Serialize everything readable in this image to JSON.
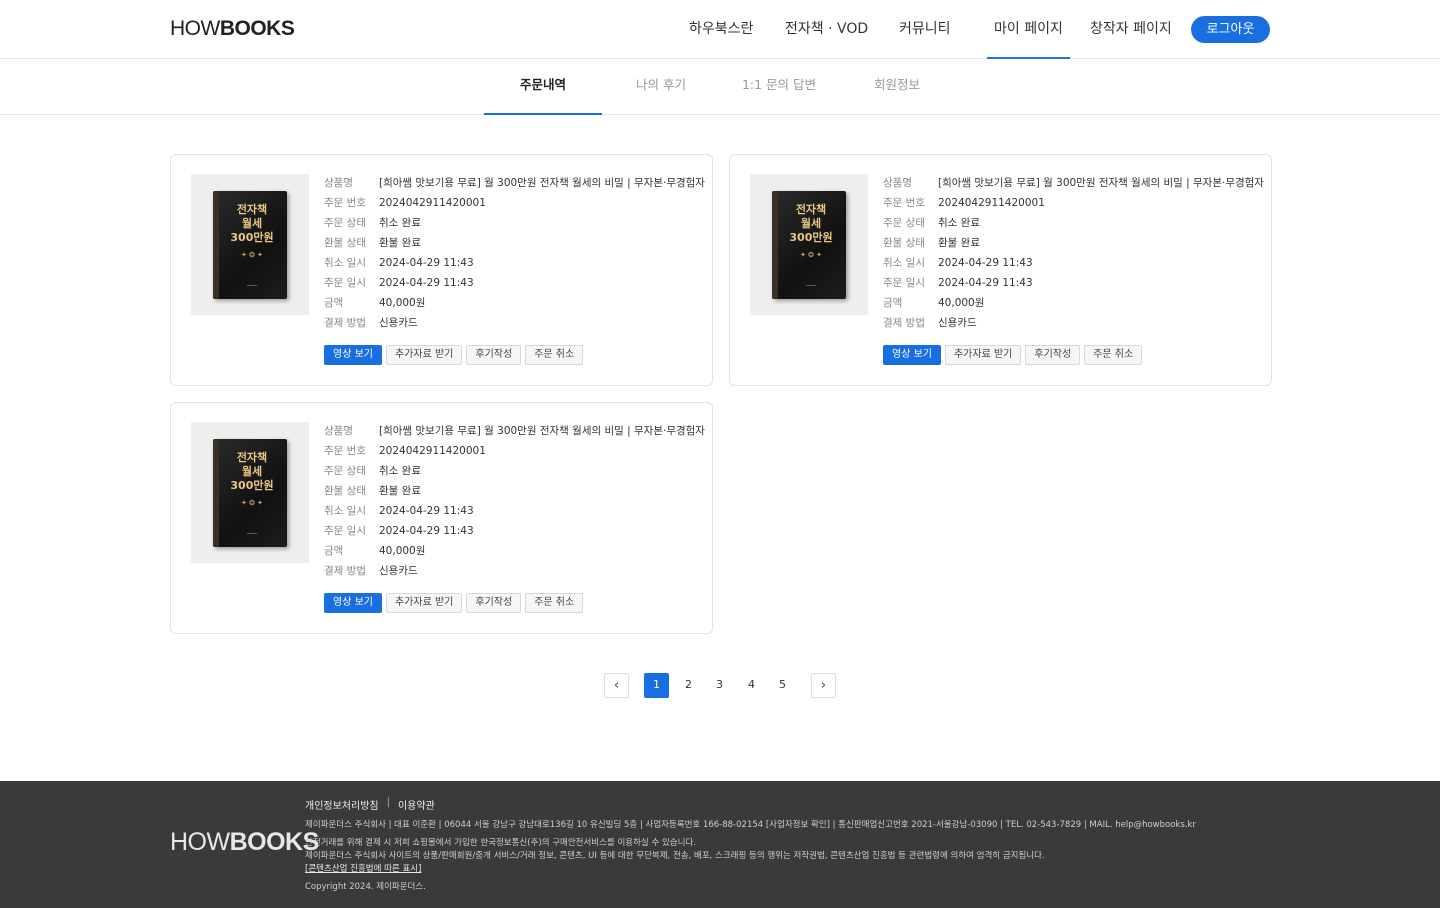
{
  "header": {
    "logo_thin": "HOW",
    "logo_bold": "BOOKS",
    "nav": [
      "하우북스란",
      "전자책 · VOD",
      "커뮤니티",
      "마이 페이지",
      "창작자 페이지"
    ],
    "logout": "로그아웃"
  },
  "tabs": [
    "주문내역",
    "나의 후기",
    "1:1 문의 답변",
    "회원정보"
  ],
  "labels": {
    "product": "상품명",
    "order_no": "주문 번호",
    "order_status": "주문 상태",
    "refund_status": "환불 상태",
    "cancel_date": "취소 일시",
    "order_date": "주문 일시",
    "amount": "금액",
    "payment": "결제 방법"
  },
  "book_cover": {
    "title_lines": [
      "전자책",
      "월세",
      "300만원"
    ]
  },
  "orders": [
    {
      "product": "[희아쌤 맛보기용 무료] 월 300만원 전자책 월세의 비밀 | 무자본·무경험자",
      "order_no": "2024042911420001",
      "order_status": "취소 완료",
      "refund_status": "환불 완료",
      "cancel_date": "2024-04-29 11:43",
      "order_date": "2024-04-29 11:43",
      "amount": "40,000원",
      "payment": "신용카드"
    },
    {
      "product": "[희아쌤 맛보기용 무료] 월 300만원 전자책 월세의 비밀 | 무자본·무경험자",
      "order_no": "2024042911420001",
      "order_status": "취소 완료",
      "refund_status": "환불 완료",
      "cancel_date": "2024-04-29 11:43",
      "order_date": "2024-04-29 11:43",
      "amount": "40,000원",
      "payment": "신용카드"
    },
    {
      "product": "[희아쌤 맛보기용 무료] 월 300만원 전자책 월세의 비밀 | 무자본·무경험자",
      "order_no": "2024042911420001",
      "order_status": "취소 완료",
      "refund_status": "환불 완료",
      "cancel_date": "2024-04-29 11:43",
      "order_date": "2024-04-29 11:43",
      "amount": "40,000원",
      "payment": "신용카드"
    }
  ],
  "actions": {
    "watch": "영상 보기",
    "extra": "추가자료 받기",
    "review": "후기작성",
    "cancel": "주문 취소"
  },
  "pagination": {
    "prev": "‹",
    "next": "›",
    "pages": [
      "1",
      "2",
      "3",
      "4",
      "5"
    ],
    "current": "1"
  },
  "footer": {
    "logo_thin": "HOW",
    "logo_bold": "BOOKS",
    "link_privacy": "개인정보처리방침",
    "link_sep": "|",
    "link_terms": "이용약관",
    "line1": "제이파운더스 주식회사  |  대표 이준환  |  06044 서울 강남구 강남대로136길 10 유신빌딩 5층  |  사업자등록번호 166-88-02154 [사업자정보 확인]  |  통신판매업신고번호 2021-서울강남-03090 | TEL. 02-543-7829 | MAIL. help@howbooks.kr",
    "line2": "안전거래를 위해 결제 시 저희 쇼핑몰에서 가입한 한국정보통신(주)의 구매안전서비스를 이용하실 수 있습니다.",
    "line3": "제이파운더스 주식회사 사이트의 상품/판매회원/중개 서비스/거래 정보, 콘텐츠, UI 등에 대한 무단복제, 전송, 배포, 스크래핑 등의 행위는 저작권법, 콘텐츠산업 진흥법 등 관련법령에 의하여 엄격히 금지됩니다.",
    "line4": "[콘텐츠산업 진흥법에 따른 표시]",
    "copyright": "Copyright 2024. 제이파운더스."
  },
  "colors": {
    "accent": "#1a6fe0",
    "footer_bg": "#3a3a3a"
  }
}
